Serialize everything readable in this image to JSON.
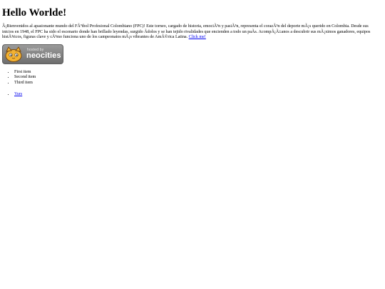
{
  "heading": "Hello Worlde!",
  "intro": {
    "text": "Â¡Bienvenidos al apasionante mundo del FÃºtbol Profesional Colombiano (FPC)! Este torneo, cargado de historia, emociÃ³n y pasiÃ³n, representa el corazÃ³n del deporte mÃ¡s querido en Colombia. Desde sus inicios en 1948, el FPC ha sido el escenario donde han brillado leyendas, surgido Ã­dolos y se han tejido rivalidades que encienden a todo un paÃ­s. AcompÃ¡Ã±anos a descubrir sus mÃ¡ximos ganadores, equipos histÃ³ricos, figuras clave y cÃ³mo funciona uno de los campeonatos mÃ¡s vibrantes de AmÃ©rica Latina.",
    "link_label": "Click me!"
  },
  "badge": {
    "small_text": "hosted by",
    "big_text": "neocities",
    "icon": "cat-icon"
  },
  "list": [
    "First item",
    "Second item",
    "Third item"
  ],
  "links": [
    "Yurs"
  ]
}
